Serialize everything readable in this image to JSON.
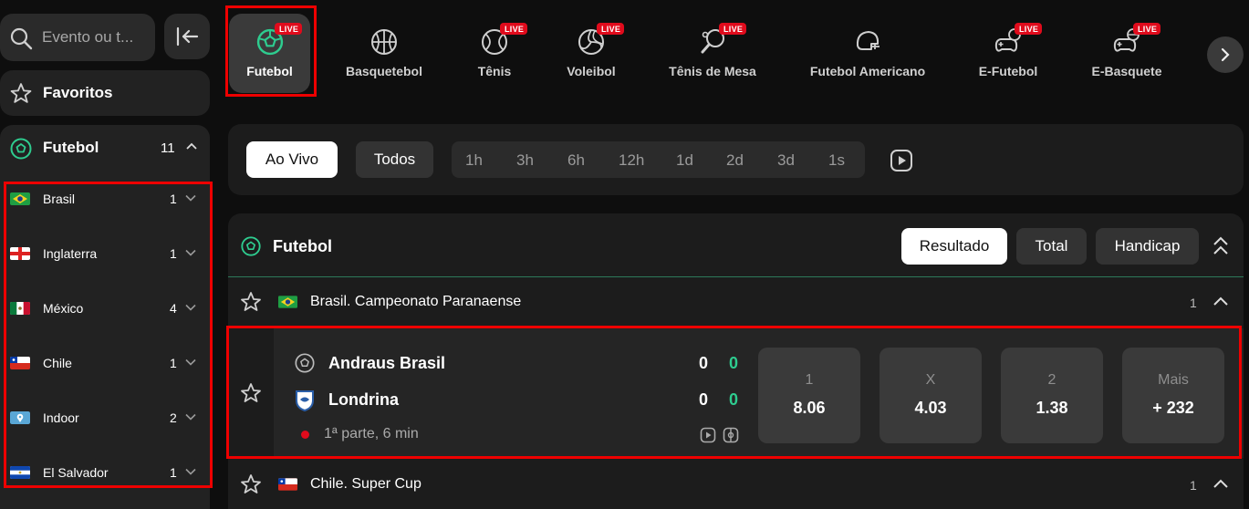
{
  "search": {
    "placeholder": "Evento ou t..."
  },
  "sidebar": {
    "favorites_label": "Favoritos",
    "sport": {
      "label": "Futebol",
      "count": "11"
    },
    "countries": [
      {
        "name": "Brasil",
        "count": "1"
      },
      {
        "name": "Inglaterra",
        "count": "1"
      },
      {
        "name": "México",
        "count": "4"
      },
      {
        "name": "Chile",
        "count": "1"
      },
      {
        "name": "Indoor",
        "count": "2"
      },
      {
        "name": "El Salvador",
        "count": "1"
      }
    ]
  },
  "sports": [
    {
      "label": "Futebol",
      "live": "LIVE",
      "icon": "soccer-ball-icon"
    },
    {
      "label": "Basquetebol",
      "live": "",
      "icon": "basketball-icon"
    },
    {
      "label": "Tênis",
      "live": "LIVE",
      "icon": "tennis-ball-icon"
    },
    {
      "label": "Voleibol",
      "live": "LIVE",
      "icon": "volleyball-icon"
    },
    {
      "label": "Tênis de Mesa",
      "live": "LIVE",
      "icon": "ping-pong-icon"
    },
    {
      "label": "Futebol Americano",
      "live": "",
      "icon": "football-helmet-icon"
    },
    {
      "label": "E-Futebol",
      "live": "LIVE",
      "icon": "gamepad-soccer-icon"
    },
    {
      "label": "E-Basquete",
      "live": "LIVE",
      "icon": "gamepad-basketball-icon"
    }
  ],
  "filters": {
    "live": "Ao Vivo",
    "all": "Todos",
    "times": [
      "1h",
      "3h",
      "6h",
      "12h",
      "1d",
      "2d",
      "3d",
      "1s"
    ]
  },
  "panel": {
    "title": "Futebol",
    "markets": [
      "Resultado",
      "Total",
      "Handicap"
    ],
    "leagues": [
      {
        "name": "Brasil. Campeonato Paranaense",
        "count": "1"
      },
      {
        "name": "Chile. Super Cup",
        "count": "1"
      }
    ],
    "match": {
      "home": {
        "name": "Andraus Brasil",
        "score": "0",
        "sub": "0"
      },
      "away": {
        "name": "Londrina",
        "score": "0",
        "sub": "0"
      },
      "status": "1ª parte, 6 min",
      "odds": [
        {
          "key": "1",
          "value": "8.06"
        },
        {
          "key": "X",
          "value": "4.03"
        },
        {
          "key": "2",
          "value": "1.38"
        },
        {
          "key": "Mais",
          "value": "+ 232"
        }
      ]
    }
  },
  "colors": {
    "accent_green": "#2ecc8f",
    "live_red": "#e00b1c",
    "highlight_red": "#e00000"
  }
}
